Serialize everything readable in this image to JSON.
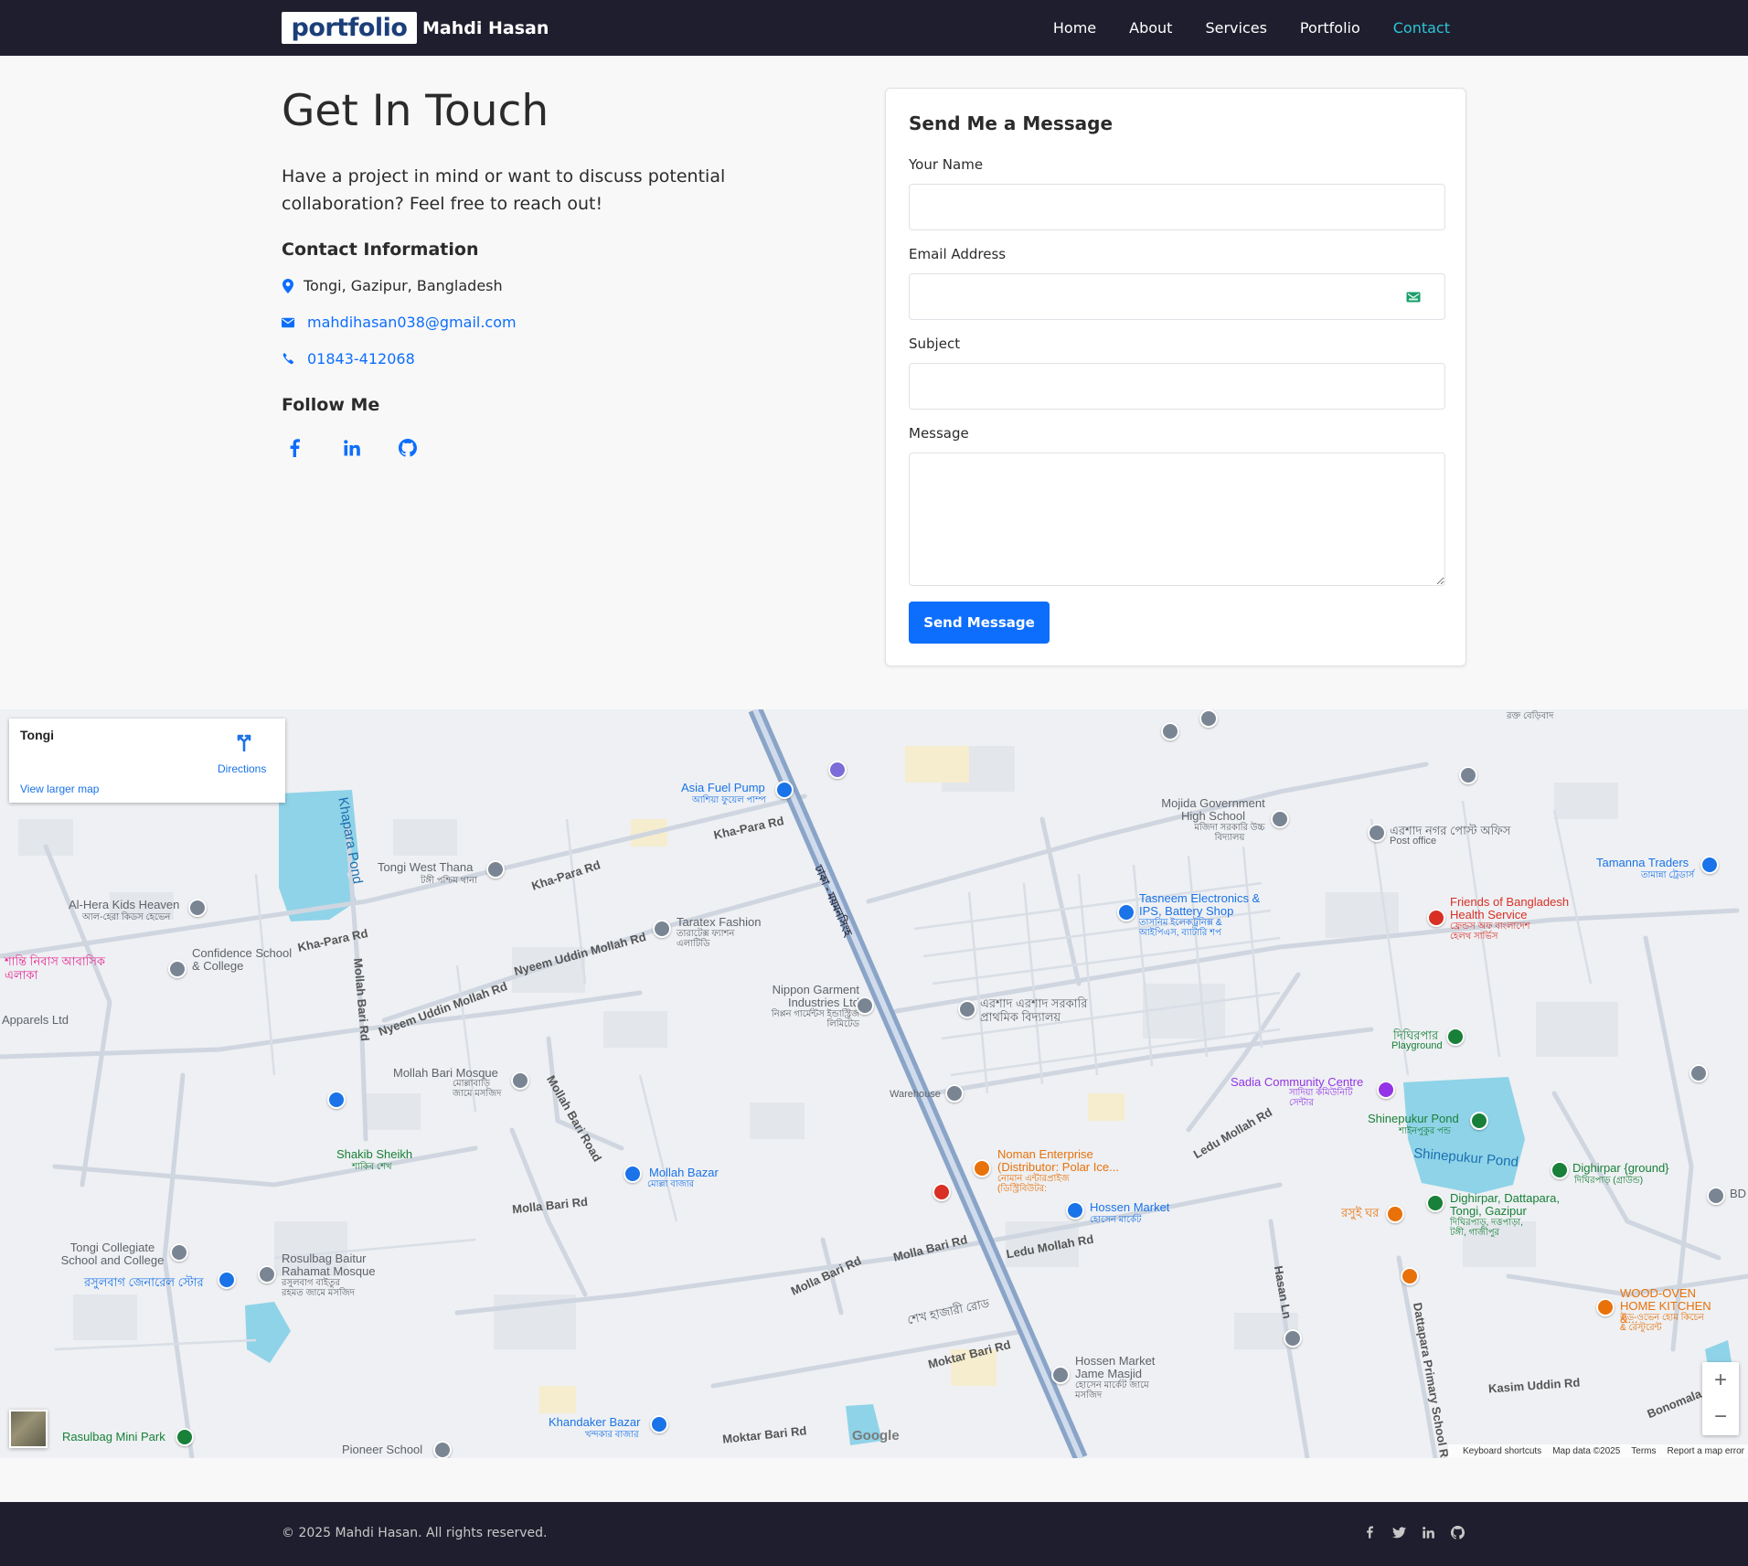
{
  "nav": {
    "logo_text": "portfolio",
    "brand_name": "Mahdi Hasan",
    "links": [
      {
        "label": "Home"
      },
      {
        "label": "About"
      },
      {
        "label": "Services"
      },
      {
        "label": "Portfolio"
      },
      {
        "label": "Contact",
        "active": true
      }
    ],
    "active_color": "#2cc5d6"
  },
  "contact": {
    "title": "Get In Touch",
    "lead": "Have a project in mind or want to discuss potential collaboration? Feel free to reach out!",
    "info_heading": "Contact Information",
    "address": "Tongi, Gazipur, Bangladesh",
    "email": "mahdihasan038@gmail.com",
    "phone": "01843-412068",
    "follow_heading": "Follow Me",
    "social_icons": [
      "facebook-icon",
      "linkedin-icon",
      "github-icon"
    ]
  },
  "form": {
    "title": "Send Me a Message",
    "name_label": "Your Name",
    "name_value": "",
    "email_label": "Email Address",
    "email_value": "",
    "subject_label": "Subject",
    "subject_value": "",
    "message_label": "Message",
    "message_value": "",
    "submit_label": "Send Message",
    "accent": "#0d6efd"
  },
  "map": {
    "place_title": "Tongi",
    "directions_label": "Directions",
    "view_larger": "View larger map",
    "labels": {
      "khapara_pond": "Khapara Pond",
      "asia_fuel": "Asia Fuel Pump",
      "asia_fuel_bn": "আশিয়া ফুয়েল পাম্প",
      "kha_para_rd": "Kha-Para Rd",
      "tongi_west_thana": "Tongi West Thana",
      "tongi_west_thana_bn": "টঙ্গী পশ্চিম থানা",
      "al_hera": "Al-Hera Kids Heaven",
      "al_hera_bn": "আল-হেরা কিডস হেভেন",
      "confidence": "Confidence School & College",
      "shanti": "শান্তি নিবাস আবাসিক এলাকা",
      "apparels": "Apparels Ltd",
      "taratex": "Taratex Fashion",
      "taratex_bn": "তারাটেক্স ফ্যাশন এলাটিডি",
      "nyeem": "Nyeem Uddin Mollah Rd",
      "mollah_bari_rd": "Mollah Bari Rd",
      "nippon": "Nippon Garment Industries Ltd",
      "nippon_bn": "নিপ্পন গার্মেন্টস ইন্ডাস্ট্রিজ লিমিটেড",
      "mollah_bari_mosque": "Mollah Bari Mosque",
      "mollah_bari_mosque_bn": "মোল্লাবাড়ি জামে মসজিদ",
      "mojida": "Mojida Government High School",
      "mojida_bn": "মজিদা সরকারি উচ্চ বিদ্যালয়",
      "ershad_post": "এরশাদ নগর পোস্ট অফিস",
      "post_office": "Post office",
      "tamanna": "Tamanna Traders",
      "tamanna_bn": "তামান্না ট্রেডার্স",
      "friends": "Friends of Bangladesh Health Service",
      "friends_bn": "ফ্রেন্ডস অফ বাংলাদেশ হেলথ সার্ভিস",
      "tasneem": "Tasneem Electronics & IPS, Battery Shop",
      "tasneem_bn": "তাসনিম ইলেকট্রনিক্স & আইপিএস, ব্যাটারি শপ",
      "ershad_school": "এরশাদ এরশাদ সরকারি প্রাথমিক বিদ্যালয়",
      "dighirpar_bn": "দিঘিরপার",
      "playground": "Playground",
      "sadia": "Sadia Community Centre",
      "sadia_bn": "সাদিয়া কমিউনিটি সেন্টার",
      "warehouse": "Warehouse",
      "shinepukur": "Shinepukur Pond",
      "shinepukur_bn": "শাইনপুকুর পন্ড",
      "shinepukur_water": "Shinepukur Pond",
      "dighirpar_ground": "Dighirpar {ground}",
      "dighirpar_ground_bn": "দিঘিরপাড় (গ্রাউন্ড)",
      "ledu_mollah": "Ledu Mollah Rd",
      "noman": "Noman Enterprise (Distributor: Polar Ice...",
      "noman_bn": "নোমান এন্টারপ্রাইজ (ডিস্ট্রিবিউটর:",
      "hossen_market": "Hossen Market",
      "hossen_market_bn": "হোসেন মার্কেট",
      "mollah_bazar": "Mollah Bazar",
      "mollah_bazar_bn": "মোল্লা বাজার",
      "shakib": "Shakib Sheikh",
      "shakib_bn": "শাকিব শেখ",
      "molla_bari_rd": "Molla Bari Rd",
      "mollah_bari_road": "Mollah Bari Road",
      "dighirpar_dattapara": "Dighirpar, Dattapara, Tongi, Gazipur",
      "dighirpar_dattapara_bn": "দিঘিরপাড়, দত্তপাড়া, টঙ্গী, গাজীপুর",
      "rasui_ghar": "রসুই ঘর",
      "bd": "BD",
      "tongi_collegiate": "Tongi Collegiate School and College",
      "rasulbag_store": "রসুলবাগ জেনারেল স্টোর",
      "rosulbag_mosque": "Rosulbag Baitur Rahamat Mosque",
      "rosulbag_mosque_bn": "রসুলবাগ বাইতুর রহমত জামে মসজিদ",
      "wood_oven": "WOOD-OVEN HOME KITCHEN &...",
      "wood_oven_bn": "উড-ওভেন হোম কিচেন & রেস্টুরেন্ট",
      "hasan_ln": "Hasan Ln",
      "dattapara_primary": "Dattapara Primary School Rd",
      "sheikh_hajari": "শেখ হাজারী রোড",
      "moktar_bari": "Moktar Bari Rd",
      "hossen_masjid": "Hossen Market Jame Masjid",
      "hossen_masjid_bn": "হোসেন মার্কেট জামে মসজিদ",
      "kasim": "Kasim Uddin Rd",
      "bonomala": "Bonomala",
      "khandaker": "Khandaker Bazar",
      "khandaker_bn": "খন্দকার বাজার",
      "rasulbag_park": "Rasulbag Mini Park",
      "pioneer": "Pioneer School",
      "highway": "ঢাকা - ময়মনসিংহ",
      "top_right_bn": "রক্ত বেড়িবাদ"
    },
    "attribution": [
      "Keyboard shortcuts",
      "Map data ©2025",
      "Terms",
      "Report a map error"
    ],
    "google_logo": "Google",
    "zoom_in": "+",
    "zoom_out": "−"
  },
  "footer": {
    "copyright": "© 2025 Mahdi Hasan. All rights reserved.",
    "icons": [
      "facebook-icon",
      "twitter-icon",
      "linkedin-icon",
      "github-icon"
    ]
  }
}
